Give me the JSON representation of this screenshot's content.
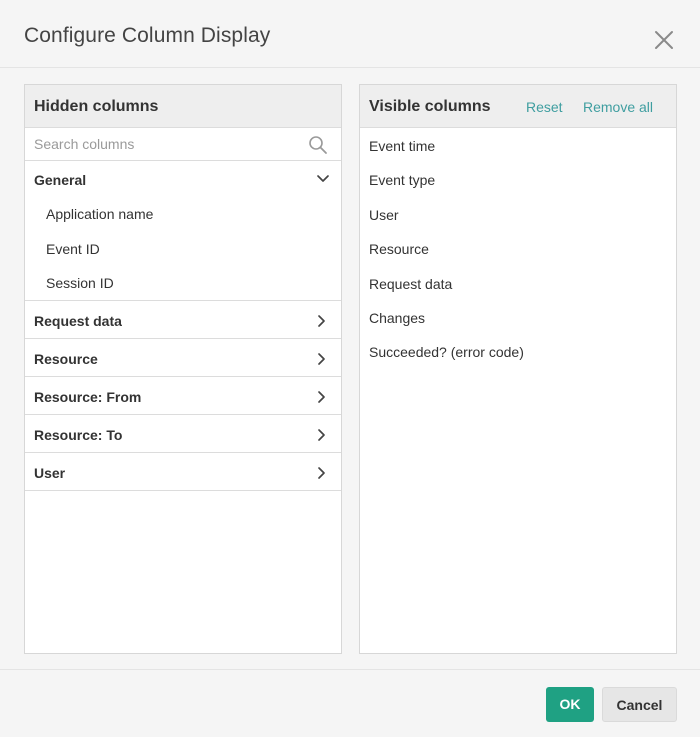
{
  "dialog": {
    "title": "Configure Column Display"
  },
  "hidden_panel": {
    "title": "Hidden columns",
    "search_placeholder": "Search columns",
    "groups": [
      {
        "label": "General",
        "expanded": true,
        "items": [
          "Application name",
          "Event ID",
          "Session ID"
        ]
      },
      {
        "label": "Request data",
        "expanded": false
      },
      {
        "label": "Resource",
        "expanded": false
      },
      {
        "label": "Resource: From",
        "expanded": false
      },
      {
        "label": "Resource: To",
        "expanded": false
      },
      {
        "label": "User",
        "expanded": false
      }
    ]
  },
  "visible_panel": {
    "title": "Visible columns",
    "reset_label": "Reset",
    "remove_all_label": "Remove all",
    "items": [
      "Event time",
      "Event type",
      "User",
      "Resource",
      "Request data",
      "Changes",
      "Succeeded? (error code)"
    ]
  },
  "footer": {
    "ok_label": "OK",
    "cancel_label": "Cancel"
  },
  "colors": {
    "accent": "#1fa183",
    "link": "#3f9ea0",
    "background": "#f5f5f5"
  },
  "icons": {
    "close": "close-icon",
    "search": "search-icon",
    "expanded": "chevron-down-icon",
    "collapsed": "chevron-right-icon"
  }
}
